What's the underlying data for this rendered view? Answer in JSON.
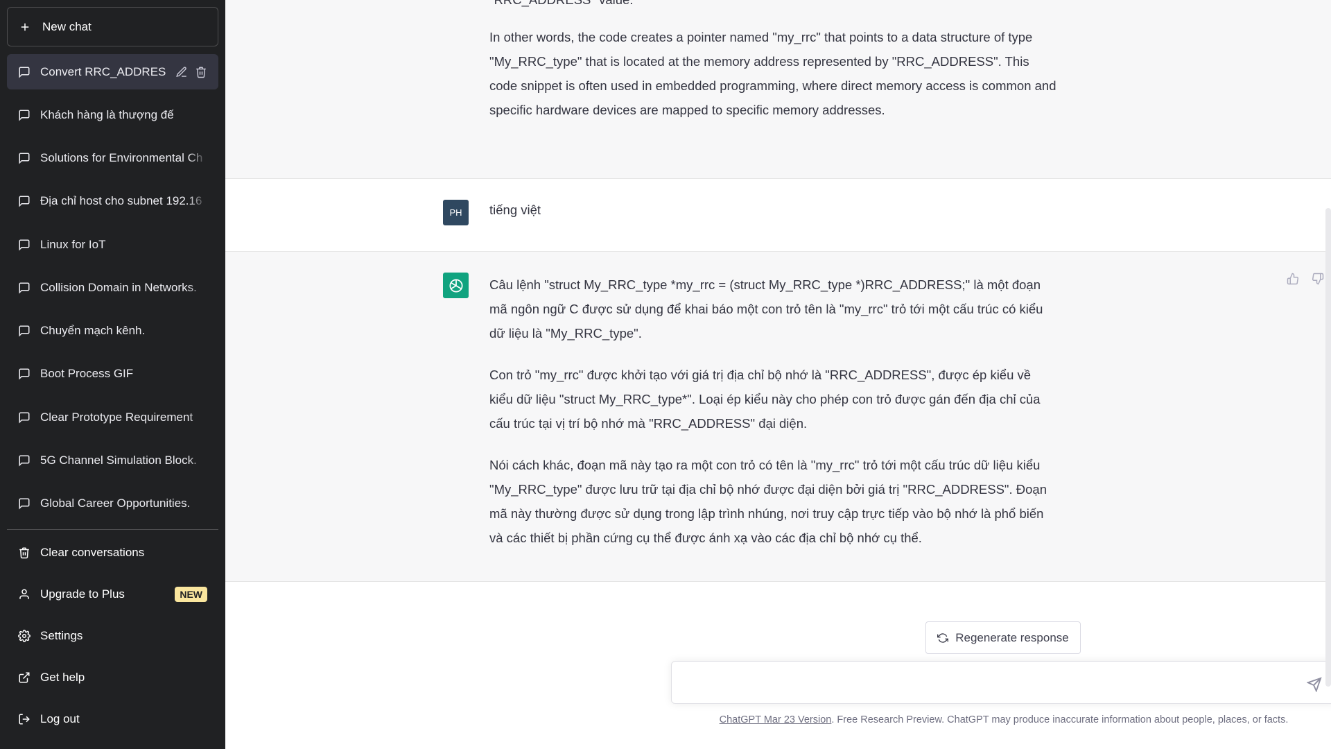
{
  "sidebar": {
    "new_chat_label": "New chat",
    "history": [
      {
        "label": "Convert RRC_ADDRES",
        "active": true
      },
      {
        "label": "Khách hàng là thượng đế"
      },
      {
        "label": "Solutions for Environmental Ch"
      },
      {
        "label": "Địa chỉ host cho subnet 192.16"
      },
      {
        "label": "Linux for IoT"
      },
      {
        "label": "Collision Domain in Networks."
      },
      {
        "label": "Chuyển mạch kênh."
      },
      {
        "label": "Boot Process GIF"
      },
      {
        "label": "Clear Prototype Requirement"
      },
      {
        "label": "5G Channel Simulation Block."
      },
      {
        "label": "Global Career Opportunities."
      }
    ],
    "bottom": {
      "clear": "Clear conversations",
      "upgrade": "Upgrade to Plus",
      "upgrade_badge": "NEW",
      "settings": "Settings",
      "help": "Get help",
      "logout": "Log out"
    }
  },
  "conversation": {
    "prev_answer": {
      "cut_line": "\"RRC_ADDRESS\" value.",
      "paragraph": "In other words, the code creates a pointer named \"my_rrc\" that points to a data structure of type \"My_RRC_type\" that is located at the memory address represented by \"RRC_ADDRESS\". This code snippet is often used in embedded programming, where direct memory access is common and specific hardware devices are mapped to specific memory addresses."
    },
    "user_message": {
      "avatar": "PH",
      "text": "tiếng việt"
    },
    "assistant_message": {
      "paragraphs": [
        "Câu lệnh \"struct My_RRC_type *my_rrc = (struct My_RRC_type *)RRC_ADDRESS;\" là một đoạn mã ngôn ngữ C được sử dụng để khai báo một con trỏ tên là \"my_rrc\" trỏ tới một cấu trúc có kiểu dữ liệu là \"My_RRC_type\".",
        "Con trỏ \"my_rrc\" được khởi tạo với giá trị địa chỉ bộ nhớ là \"RRC_ADDRESS\", được ép kiểu về kiểu dữ liệu \"struct My_RRC_type*\". Loại ép kiểu này cho phép con trỏ được gán đến địa chỉ của cấu trúc tại vị trí bộ nhớ mà \"RRC_ADDRESS\" đại diện.",
        "Nói cách khác, đoạn mã này tạo ra một con trỏ có tên là \"my_rrc\" trỏ tới một cấu trúc dữ liệu kiểu \"My_RRC_type\" được lưu trữ tại địa chỉ bộ nhớ được đại diện bởi giá trị \"RRC_ADDRESS\". Đoạn mã này thường được sử dụng trong lập trình nhúng, nơi truy cập trực tiếp vào bộ nhớ là phổ biến và các thiết bị phần cứng cụ thể được ánh xạ vào các địa chỉ bộ nhớ cụ thể."
      ]
    }
  },
  "composer": {
    "regenerate_label": "Regenerate response",
    "input_value": "",
    "footer_link": "ChatGPT Mar 23 Version",
    "footer_text": ". Free Research Preview. ChatGPT may produce inaccurate information about people, places, or facts."
  },
  "colors": {
    "sidebar_bg": "#202123",
    "assistant_bg": "#f7f7f8",
    "gpt_accent": "#10a37f",
    "new_badge": "#fae69e"
  }
}
